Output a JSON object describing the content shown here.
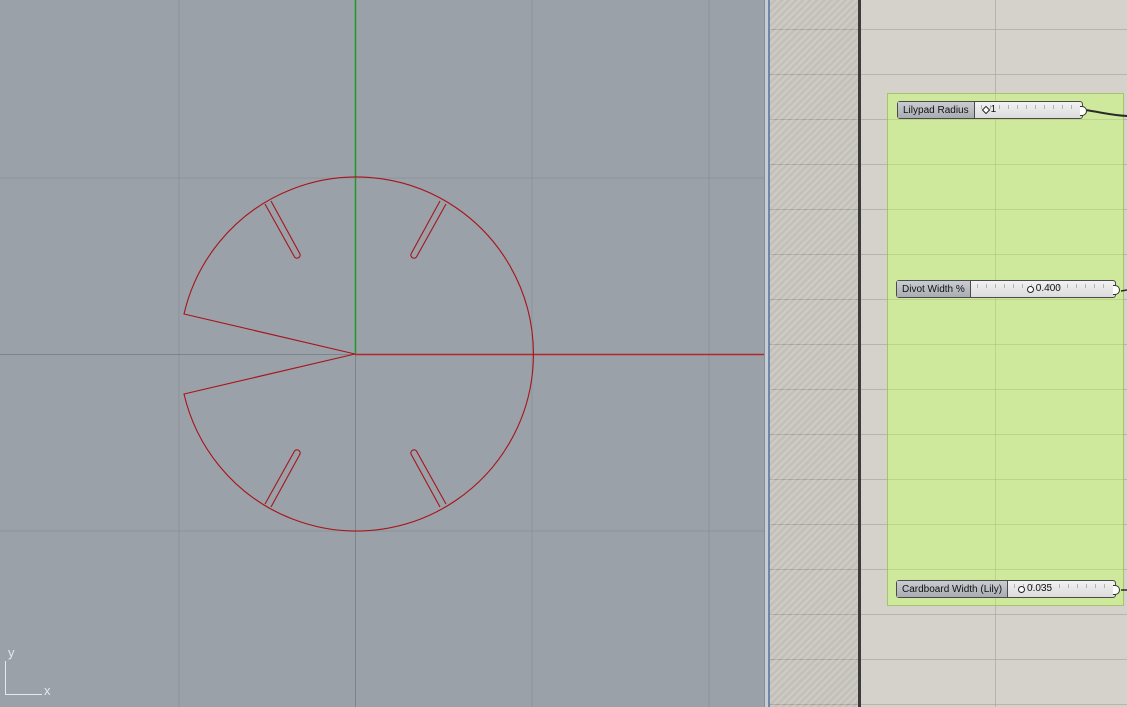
{
  "viewport": {
    "axis_indicator": {
      "y_label": "y",
      "x_label": "x"
    },
    "colors": {
      "background": "#9aa1a8",
      "grid": "#8c939a",
      "x_axis": "#b3262b",
      "y_axis": "#1f9a2a",
      "curve": "#a8141b"
    }
  },
  "canvas": {
    "colors": {
      "background": "#d5d2cb",
      "group": "#cfe99c"
    },
    "sliders": [
      {
        "label": "Lilypad Radius",
        "value": "1",
        "fraction": 0.0
      },
      {
        "label": "Divot Width %",
        "value": "0.400",
        "fraction": 0.4
      },
      {
        "label": "Cardboard Width (Lily)",
        "value": "0.035",
        "fraction": 0.0
      }
    ]
  }
}
